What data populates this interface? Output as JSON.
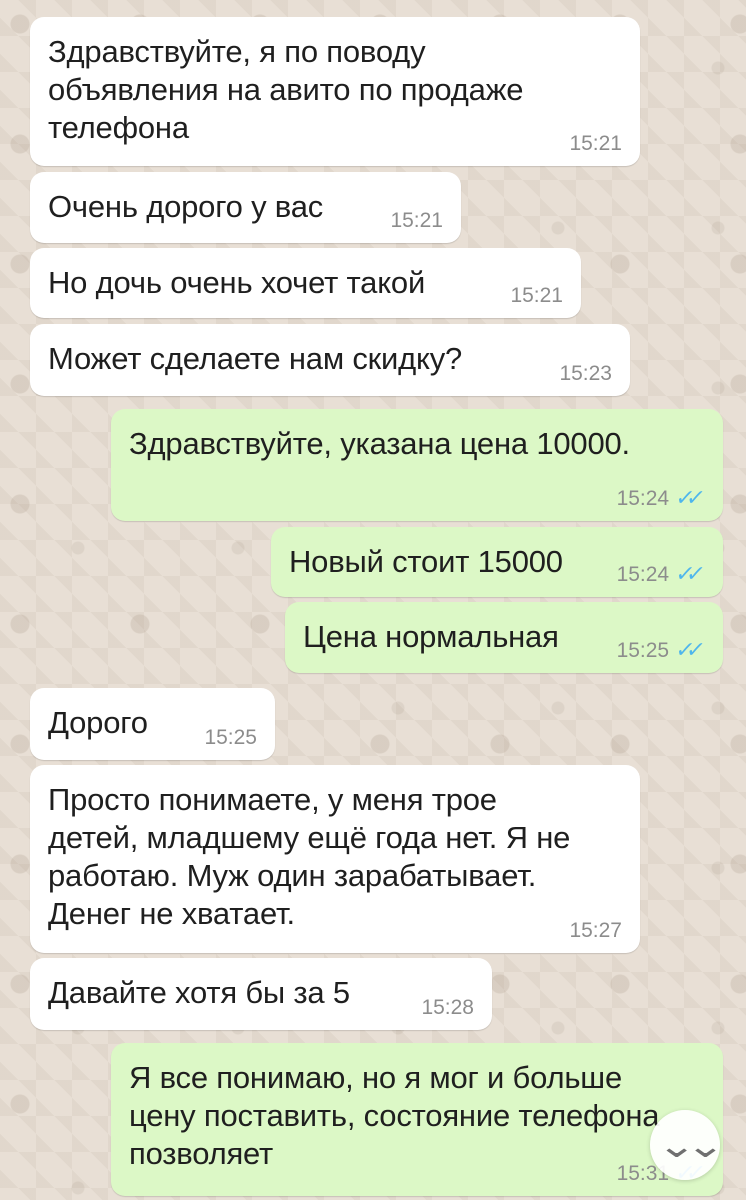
{
  "messages": [
    {
      "direction": "incoming",
      "text": "Здравствуйте, я по поводу\nобъявления на авито по продаже\nтелефона",
      "time": "15:21"
    },
    {
      "direction": "incoming",
      "text": "Очень дорого у вас",
      "time": "15:21"
    },
    {
      "direction": "incoming",
      "text": "Но дочь очень хочет такой",
      "time": "15:21"
    },
    {
      "direction": "incoming",
      "text": "Может сделаете нам скидку?",
      "time": "15:23"
    },
    {
      "direction": "outgoing",
      "text": "Здравствуйте, указана цена 10000.",
      "time": "15:24",
      "status": "read"
    },
    {
      "direction": "outgoing",
      "text": "Новый стоит 15000",
      "time": "15:24",
      "status": "read"
    },
    {
      "direction": "outgoing",
      "text": "Цена нормальная",
      "time": "15:25",
      "status": "read"
    },
    {
      "direction": "incoming",
      "text": "Дорого",
      "time": "15:25"
    },
    {
      "direction": "incoming",
      "text": "Просто понимаете, у меня трое\nдетей, младшему ещё года нет. Я не\nработаю. Муж один зарабатывает.\nДенег не хватает.",
      "time": "15:27"
    },
    {
      "direction": "incoming",
      "text": "Давайте хотя бы за 5",
      "time": "15:28"
    },
    {
      "direction": "outgoing",
      "text": "Я все понимаю, но я мог и больше\nцену поставить, состояние телефона\nпозволяет",
      "time": "15:31",
      "status": "read"
    }
  ],
  "icons": {
    "read_receipt": "double-check-icon",
    "scroll_down": "double-chevron-down-icon"
  },
  "colors": {
    "incoming_bubble": "#ffffff",
    "outgoing_bubble": "#dcf8c6",
    "read_receipt": "#4fb6ec",
    "wallpaper": "#e8dfd5"
  }
}
